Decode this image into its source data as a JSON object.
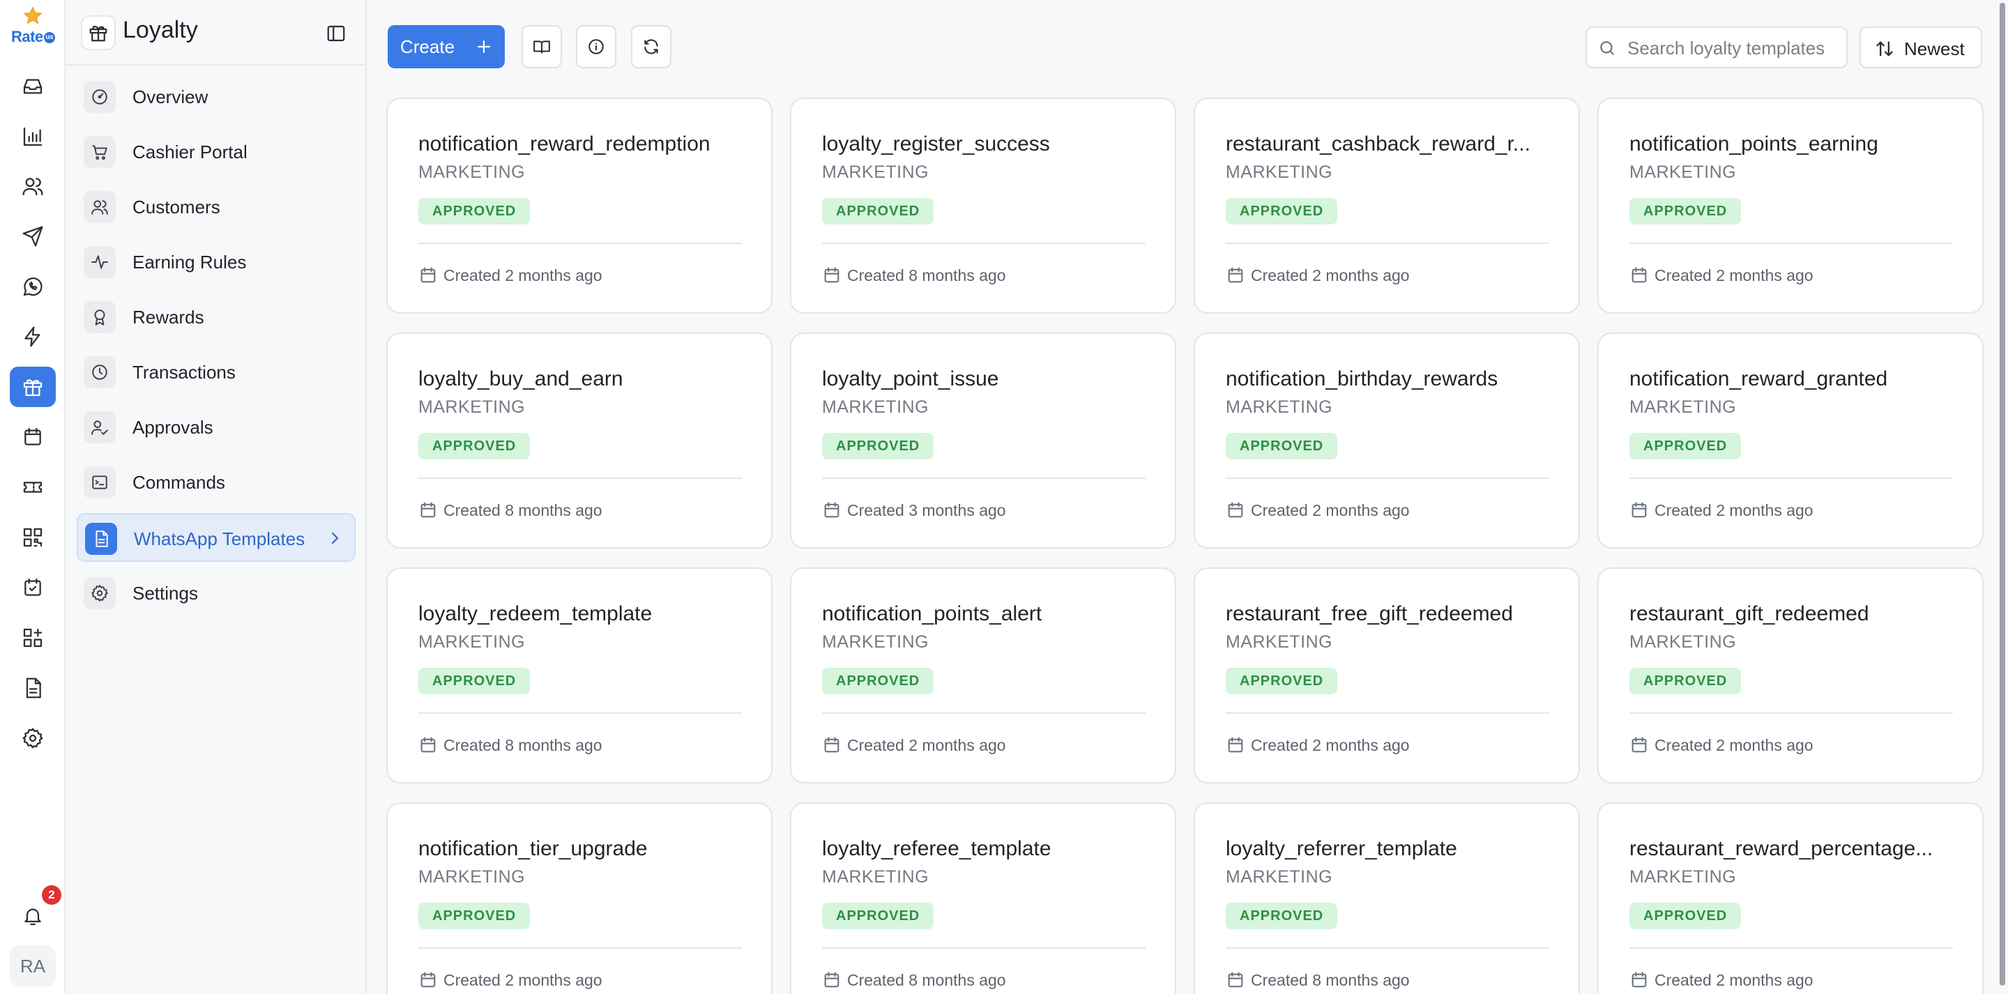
{
  "app": {
    "logo_text": "Rate",
    "logo_badge": "us",
    "brand_color": "#3a7ae6",
    "notifications_count": "2",
    "avatar_initials": "RA"
  },
  "rail": {
    "items": [
      {
        "icon": "inbox-icon"
      },
      {
        "icon": "bar-chart-icon"
      },
      {
        "icon": "users-icon"
      },
      {
        "icon": "send-icon"
      },
      {
        "icon": "whatsapp-icon"
      },
      {
        "icon": "zap-icon"
      },
      {
        "icon": "gift-icon",
        "active": true
      },
      {
        "icon": "calendar-window-icon"
      },
      {
        "icon": "ticket-icon"
      },
      {
        "icon": "qr-code-icon"
      },
      {
        "icon": "calendar-check-icon"
      },
      {
        "icon": "apps-icon"
      },
      {
        "icon": "document-icon"
      },
      {
        "icon": "settings-icon"
      }
    ]
  },
  "sidebar": {
    "title": "Loyalty",
    "items": [
      {
        "label": "Overview",
        "icon": "gauge-icon"
      },
      {
        "label": "Cashier Portal",
        "icon": "cart-icon"
      },
      {
        "label": "Customers",
        "icon": "users-icon"
      },
      {
        "label": "Earning Rules",
        "icon": "activity-icon"
      },
      {
        "label": "Rewards",
        "icon": "award-icon"
      },
      {
        "label": "Transactions",
        "icon": "clock-icon"
      },
      {
        "label": "Approvals",
        "icon": "user-check-icon"
      },
      {
        "label": "Commands",
        "icon": "terminal-icon"
      },
      {
        "label": "WhatsApp Templates",
        "icon": "file-text-icon",
        "active": true
      },
      {
        "label": "Settings",
        "icon": "gear-icon"
      }
    ]
  },
  "toolbar": {
    "create_label": "Create",
    "search_placeholder": "Search loyalty templates",
    "sort_label": "Newest"
  },
  "templates": [
    {
      "name": "notification_reward_redemption",
      "category": "MARKETING",
      "status": "APPROVED",
      "created": "Created 2 months ago"
    },
    {
      "name": "loyalty_register_success",
      "category": "MARKETING",
      "status": "APPROVED",
      "created": "Created 8 months ago"
    },
    {
      "name": "restaurant_cashback_reward_r...",
      "category": "MARKETING",
      "status": "APPROVED",
      "created": "Created 2 months ago"
    },
    {
      "name": "notification_points_earning",
      "category": "MARKETING",
      "status": "APPROVED",
      "created": "Created 2 months ago"
    },
    {
      "name": "loyalty_buy_and_earn",
      "category": "MARKETING",
      "status": "APPROVED",
      "created": "Created 8 months ago"
    },
    {
      "name": "loyalty_point_issue",
      "category": "MARKETING",
      "status": "APPROVED",
      "created": "Created 3 months ago"
    },
    {
      "name": "notification_birthday_rewards",
      "category": "MARKETING",
      "status": "APPROVED",
      "created": "Created 2 months ago"
    },
    {
      "name": "notification_reward_granted",
      "category": "MARKETING",
      "status": "APPROVED",
      "created": "Created 2 months ago"
    },
    {
      "name": "loyalty_redeem_template",
      "category": "MARKETING",
      "status": "APPROVED",
      "created": "Created 8 months ago"
    },
    {
      "name": "notification_points_alert",
      "category": "MARKETING",
      "status": "APPROVED",
      "created": "Created 2 months ago"
    },
    {
      "name": "restaurant_free_gift_redeemed",
      "category": "MARKETING",
      "status": "APPROVED",
      "created": "Created 2 months ago"
    },
    {
      "name": "restaurant_gift_redeemed",
      "category": "MARKETING",
      "status": "APPROVED",
      "created": "Created 2 months ago"
    },
    {
      "name": "notification_tier_upgrade",
      "category": "MARKETING",
      "status": "APPROVED",
      "created": "Created 2 months ago"
    },
    {
      "name": "loyalty_referee_template",
      "category": "MARKETING",
      "status": "APPROVED",
      "created": "Created 8 months ago"
    },
    {
      "name": "loyalty_referrer_template",
      "category": "MARKETING",
      "status": "APPROVED",
      "created": "Created 8 months ago"
    },
    {
      "name": "restaurant_reward_percentage...",
      "category": "MARKETING",
      "status": "APPROVED",
      "created": "Created 2 months ago"
    }
  ]
}
